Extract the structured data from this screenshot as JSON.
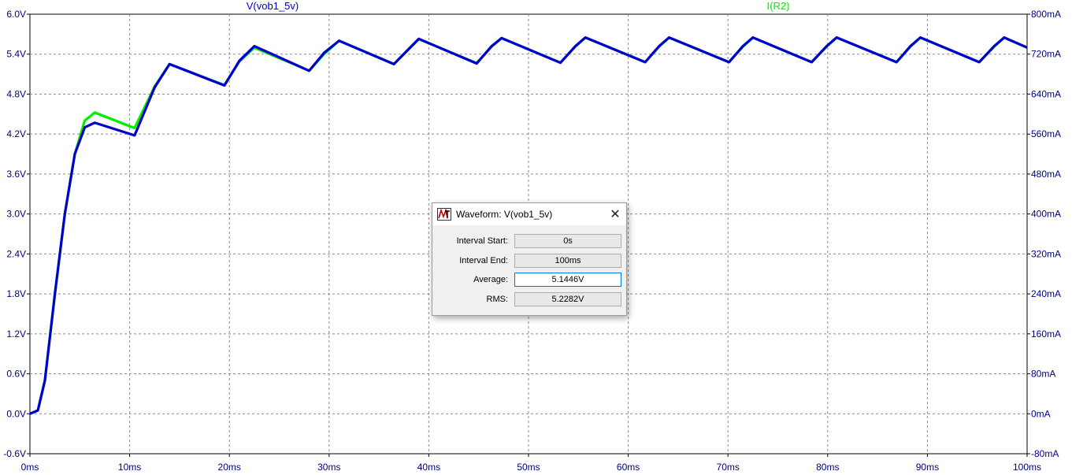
{
  "chart_data": {
    "type": "line",
    "x_ticks": [
      "0ms",
      "10ms",
      "20ms",
      "30ms",
      "40ms",
      "50ms",
      "60ms",
      "70ms",
      "80ms",
      "90ms",
      "100ms"
    ],
    "xlim": [
      0,
      100
    ],
    "y_left_ticks": [
      "6.0V",
      "5.4V",
      "4.8V",
      "4.2V",
      "3.6V",
      "3.0V",
      "2.4V",
      "1.8V",
      "1.2V",
      "0.6V",
      "0.0V",
      "-0.6V"
    ],
    "ylim_left": [
      -0.6,
      6.0
    ],
    "y_right_ticks": [
      "800mA",
      "720mA",
      "640mA",
      "560mA",
      "480mA",
      "400mA",
      "320mA",
      "240mA",
      "160mA",
      "80mA",
      "0mA",
      "-80mA"
    ],
    "ylim_right": [
      -80,
      800
    ],
    "grid": true,
    "series": [
      {
        "name": "V(vob1_5v)",
        "axis": "left",
        "color": "#0000cc",
        "x": [
          0,
          0.8,
          1.5,
          2.5,
          3.5,
          4.5,
          5.5,
          6.5,
          10.5,
          12.5,
          14,
          19.5,
          21,
          22.5,
          28,
          29.5,
          31,
          36.5,
          38,
          39,
          44.8,
          46.3,
          47.3,
          53.2,
          54.7,
          55.7,
          61.7,
          63.1,
          64.1,
          70.1,
          71.5,
          72.5,
          78.4,
          79.9,
          80.9,
          86.9,
          88.3,
          89.3,
          95.2,
          96.7,
          97.7,
          100
        ],
        "values": [
          0,
          0.05,
          0.5,
          1.8,
          3.0,
          3.9,
          4.3,
          4.37,
          4.18,
          4.9,
          5.25,
          4.93,
          5.3,
          5.52,
          5.15,
          5.42,
          5.6,
          5.25,
          5.48,
          5.63,
          5.26,
          5.52,
          5.64,
          5.27,
          5.52,
          5.65,
          5.28,
          5.52,
          5.65,
          5.28,
          5.52,
          5.65,
          5.28,
          5.52,
          5.65,
          5.28,
          5.52,
          5.65,
          5.28,
          5.52,
          5.65,
          5.5
        ]
      },
      {
        "name": "I(R2)",
        "axis": "right",
        "color": "#00ee00",
        "x": [
          0,
          0.8,
          1.5,
          2.5,
          3.5,
          4.5,
          5.5,
          6.5,
          10.5,
          12.5,
          14,
          19.5,
          21,
          22.5,
          28,
          29.5,
          31,
          36.5,
          38,
          39,
          44.8,
          46.3,
          47.3,
          53.2,
          54.7,
          55.7,
          61.7,
          63.1,
          64.1,
          70.1,
          71.5,
          72.5,
          78.4,
          79.9,
          80.9,
          86.9,
          88.3,
          89.3,
          95.2,
          96.7,
          97.7,
          100
        ],
        "values": [
          0,
          7,
          67,
          240,
          400,
          520,
          587,
          603,
          572,
          655,
          700,
          658,
          705,
          733,
          687,
          720,
          747,
          700,
          730,
          750,
          702,
          735,
          752,
          703,
          735,
          753,
          704,
          735,
          753,
          704,
          735,
          753,
          704,
          735,
          753,
          704,
          735,
          753,
          704,
          735,
          753,
          733
        ]
      }
    ]
  },
  "dialog": {
    "title": "Waveform: V(vob1_5v)",
    "close_glyph": "✕",
    "icon_name": "ltspice-icon",
    "rows": [
      {
        "label": "Interval Start:",
        "value": "0s"
      },
      {
        "label": "Interval End:",
        "value": "100ms"
      },
      {
        "label": "Average:",
        "value": "5.1446V"
      },
      {
        "label": "RMS:",
        "value": "5.2282V"
      }
    ]
  }
}
